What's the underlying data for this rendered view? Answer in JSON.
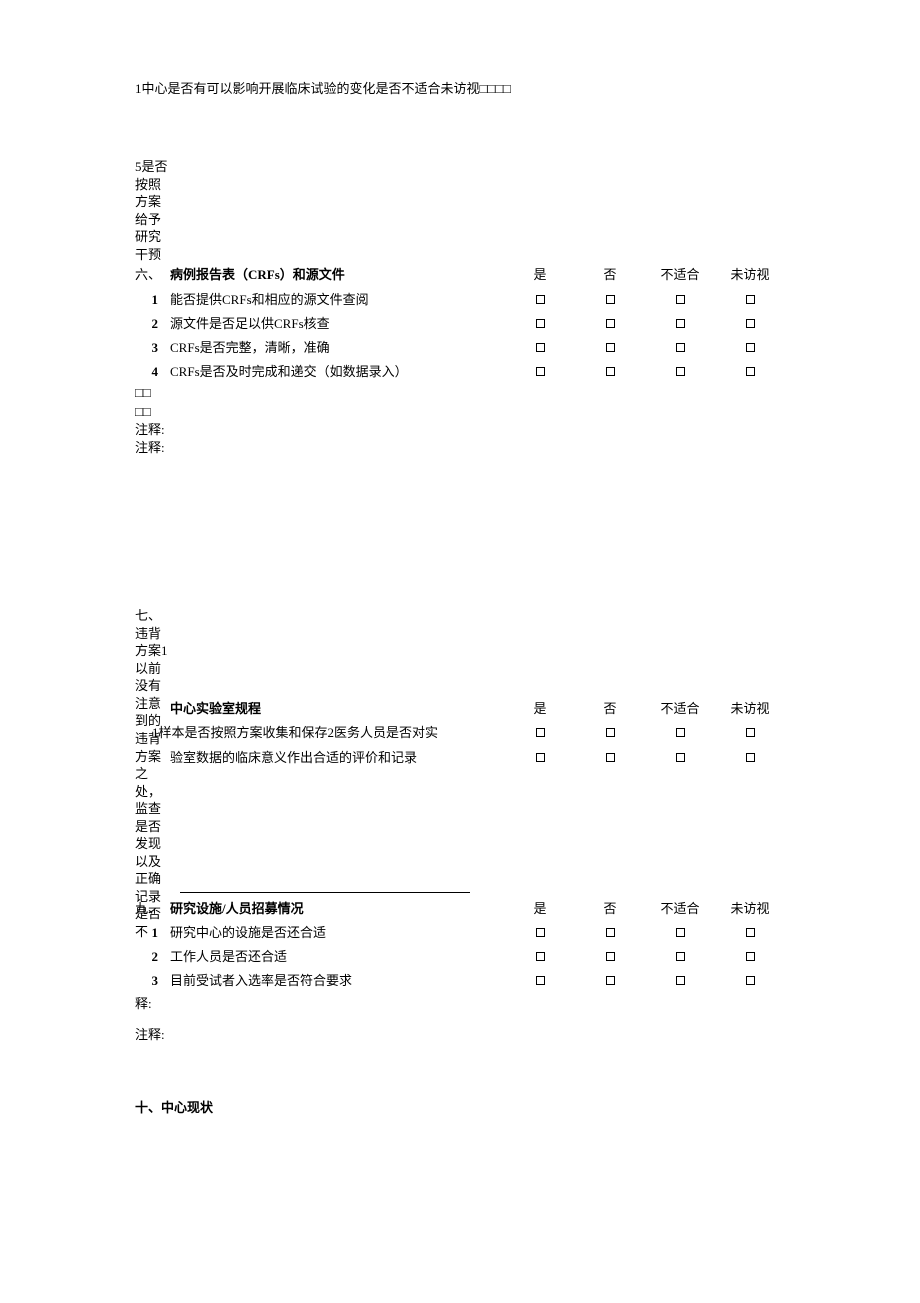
{
  "top_line": "1中心是否有可以影响开展临床试验的变化是否不适合未访视□□□□",
  "block5": "5是否按照方案给予研究干预",
  "headers": {
    "yes": "是",
    "no": "否",
    "na": "不适合",
    "nv": "未访视"
  },
  "section6": {
    "label": "六、",
    "title": "病例报告表（CRFs）和源文件",
    "rows": [
      {
        "n": "1",
        "t": "能否提供CRFs和相应的源文件查阅"
      },
      {
        "n": "2",
        "t": "源文件是否足以供CRFs核查"
      },
      {
        "n": "3",
        "t": "CRFs是否完整，清晰，准确"
      },
      {
        "n": "4",
        "t": "CRFs是否及时完成和递交（如数据录入）"
      }
    ],
    "tail": "□□\n□□\n注释:\n注释:"
  },
  "block7": "七、违背方案1以前没有注意到的违背方案之处，监查是否发现以及正确记录是否不",
  "section8": {
    "title": "中心实验室规程",
    "row1": "1样本是否按照方案收集和保存2医务人员是否对实",
    "row2": "验室数据的临床意义作出合适的评价和记录",
    "narrow2": "适合未访视",
    "tail": "释:"
  },
  "section9": {
    "label": "九、",
    "title": "研究设施/人员招募情况",
    "rows": [
      {
        "n": "1",
        "t": "研究中心的设施是否还合适"
      },
      {
        "n": "2",
        "t": "工作人员是否还合适"
      },
      {
        "n": "3",
        "t": "目前受试者入选率是否符合要求"
      }
    ]
  },
  "annot": "注释:",
  "section10": "十、中心现状"
}
